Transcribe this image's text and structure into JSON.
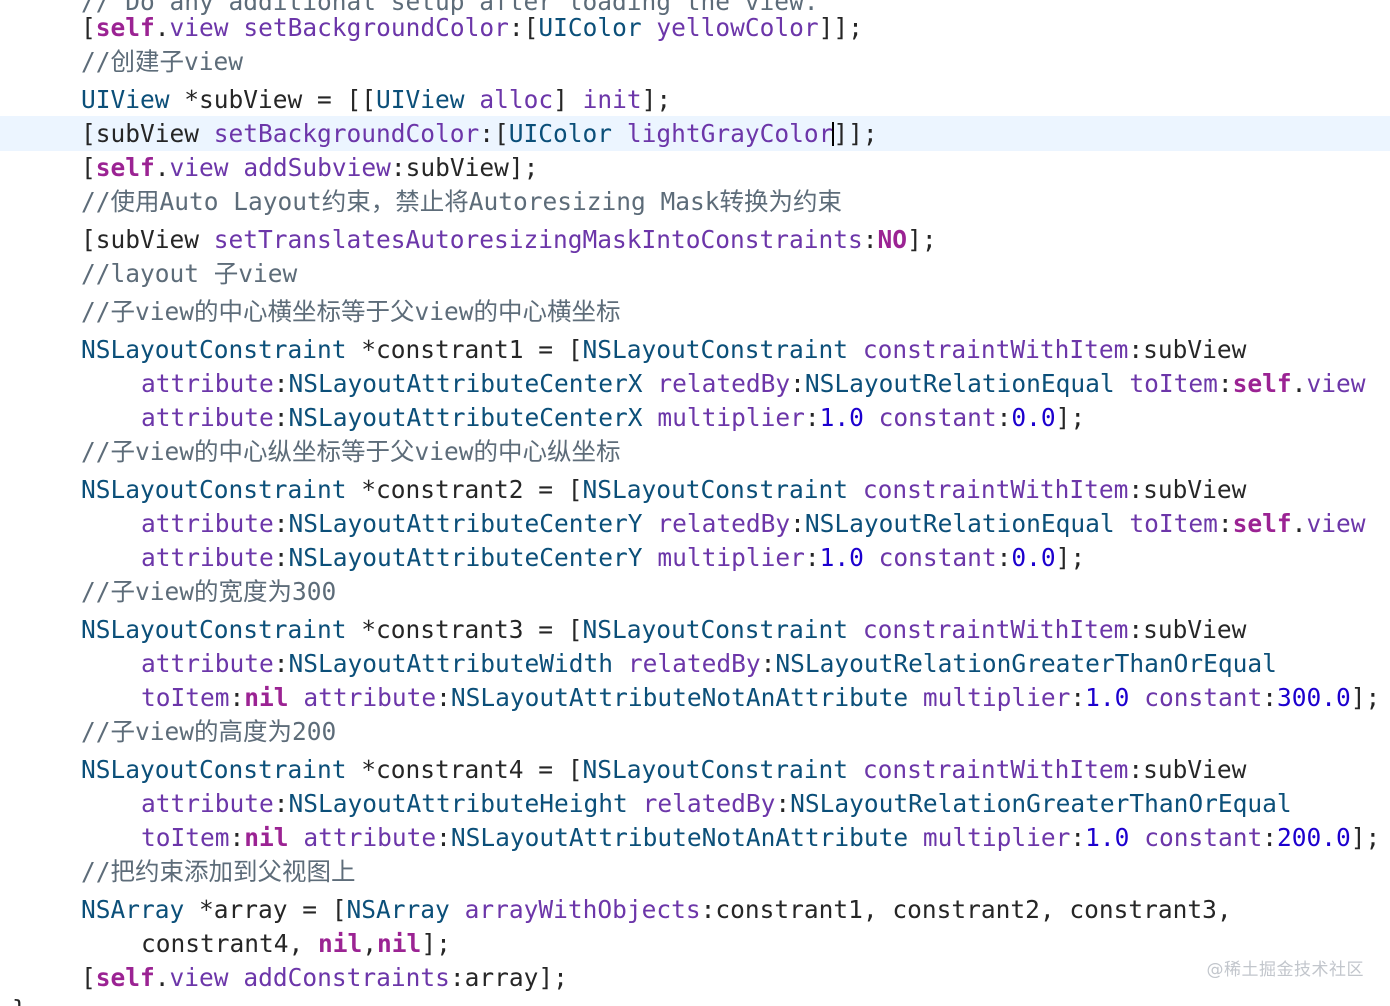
{
  "editor": {
    "lines": [
      {
        "indent": 1,
        "tokens": [
          {
            "c": "c",
            "t": "// Do any additional setup after loading the view."
          }
        ]
      },
      {
        "indent": 1,
        "tokens": [
          {
            "c": "p",
            "t": "["
          },
          {
            "c": "k",
            "t": "self"
          },
          {
            "c": "p",
            "t": "."
          },
          {
            "c": "m",
            "t": "view"
          },
          {
            "c": "p",
            "t": " "
          },
          {
            "c": "m",
            "t": "setBackgroundColor"
          },
          {
            "c": "p",
            "t": ":["
          },
          {
            "c": "t",
            "t": "UIColor"
          },
          {
            "c": "p",
            "t": " "
          },
          {
            "c": "m",
            "t": "yellowColor"
          },
          {
            "c": "p",
            "t": "]];"
          }
        ]
      },
      {
        "indent": 1,
        "tokens": [
          {
            "c": "c",
            "t": "//创建子view"
          }
        ]
      },
      {
        "indent": 1,
        "tokens": [
          {
            "c": "t",
            "t": "UIView"
          },
          {
            "c": "p",
            "t": " *subView = [["
          },
          {
            "c": "t",
            "t": "UIView"
          },
          {
            "c": "p",
            "t": " "
          },
          {
            "c": "m",
            "t": "alloc"
          },
          {
            "c": "p",
            "t": "] "
          },
          {
            "c": "m",
            "t": "init"
          },
          {
            "c": "p",
            "t": "];"
          }
        ]
      },
      {
        "indent": 1,
        "current": true,
        "tokens": [
          {
            "c": "p",
            "t": "[subView "
          },
          {
            "c": "m",
            "t": "setBackgroundColor"
          },
          {
            "c": "p",
            "t": ":["
          },
          {
            "c": "t",
            "t": "UIColor"
          },
          {
            "c": "p",
            "t": " "
          },
          {
            "c": "m",
            "t": "lightGrayColor"
          },
          {
            "c": "cursor",
            "t": ""
          },
          {
            "c": "p",
            "t": "]];"
          }
        ]
      },
      {
        "indent": 1,
        "tokens": [
          {
            "c": "p",
            "t": "["
          },
          {
            "c": "k",
            "t": "self"
          },
          {
            "c": "p",
            "t": "."
          },
          {
            "c": "m",
            "t": "view"
          },
          {
            "c": "p",
            "t": " "
          },
          {
            "c": "m",
            "t": "addSubview"
          },
          {
            "c": "p",
            "t": ":subView];"
          }
        ]
      },
      {
        "indent": 1,
        "tokens": [
          {
            "c": "c",
            "t": "//使用Auto Layout约束，禁止将Autoresizing Mask转换为约束"
          }
        ]
      },
      {
        "indent": 1,
        "tokens": [
          {
            "c": "p",
            "t": "[subView "
          },
          {
            "c": "m",
            "t": "setTranslatesAutoresizingMaskIntoConstraints"
          },
          {
            "c": "p",
            "t": ":"
          },
          {
            "c": "k",
            "t": "NO"
          },
          {
            "c": "p",
            "t": "];"
          }
        ]
      },
      {
        "indent": 1,
        "tokens": [
          {
            "c": "c",
            "t": "//layout 子view"
          }
        ]
      },
      {
        "indent": 1,
        "tokens": [
          {
            "c": "c",
            "t": "//子view的中心横坐标等于父view的中心横坐标"
          }
        ]
      },
      {
        "indent": 1,
        "tokens": [
          {
            "c": "t",
            "t": "NSLayoutConstraint"
          },
          {
            "c": "p",
            "t": " *constrant1 = ["
          },
          {
            "c": "t",
            "t": "NSLayoutConstraint"
          },
          {
            "c": "p",
            "t": " "
          },
          {
            "c": "m",
            "t": "constraintWithItem"
          },
          {
            "c": "p",
            "t": ":subView"
          }
        ]
      },
      {
        "indent": 2,
        "tokens": [
          {
            "c": "m",
            "t": "attribute"
          },
          {
            "c": "p",
            "t": ":"
          },
          {
            "c": "t",
            "t": "NSLayoutAttributeCenterX"
          },
          {
            "c": "p",
            "t": " "
          },
          {
            "c": "m",
            "t": "relatedBy"
          },
          {
            "c": "p",
            "t": ":"
          },
          {
            "c": "t",
            "t": "NSLayoutRelationEqual"
          },
          {
            "c": "p",
            "t": " "
          },
          {
            "c": "m",
            "t": "toItem"
          },
          {
            "c": "p",
            "t": ":"
          },
          {
            "c": "k",
            "t": "self"
          },
          {
            "c": "p",
            "t": "."
          },
          {
            "c": "m",
            "t": "view"
          }
        ]
      },
      {
        "indent": 2,
        "tokens": [
          {
            "c": "m",
            "t": "attribute"
          },
          {
            "c": "p",
            "t": ":"
          },
          {
            "c": "t",
            "t": "NSLayoutAttributeCenterX"
          },
          {
            "c": "p",
            "t": " "
          },
          {
            "c": "m",
            "t": "multiplier"
          },
          {
            "c": "p",
            "t": ":"
          },
          {
            "c": "n",
            "t": "1.0"
          },
          {
            "c": "p",
            "t": " "
          },
          {
            "c": "m",
            "t": "constant"
          },
          {
            "c": "p",
            "t": ":"
          },
          {
            "c": "n",
            "t": "0.0"
          },
          {
            "c": "p",
            "t": "];"
          }
        ]
      },
      {
        "indent": 1,
        "tokens": [
          {
            "c": "c",
            "t": "//子view的中心纵坐标等于父view的中心纵坐标"
          }
        ]
      },
      {
        "indent": 1,
        "tokens": [
          {
            "c": "t",
            "t": "NSLayoutConstraint"
          },
          {
            "c": "p",
            "t": " *constrant2 = ["
          },
          {
            "c": "t",
            "t": "NSLayoutConstraint"
          },
          {
            "c": "p",
            "t": " "
          },
          {
            "c": "m",
            "t": "constraintWithItem"
          },
          {
            "c": "p",
            "t": ":subView"
          }
        ]
      },
      {
        "indent": 2,
        "tokens": [
          {
            "c": "m",
            "t": "attribute"
          },
          {
            "c": "p",
            "t": ":"
          },
          {
            "c": "t",
            "t": "NSLayoutAttributeCenterY"
          },
          {
            "c": "p",
            "t": " "
          },
          {
            "c": "m",
            "t": "relatedBy"
          },
          {
            "c": "p",
            "t": ":"
          },
          {
            "c": "t",
            "t": "NSLayoutRelationEqual"
          },
          {
            "c": "p",
            "t": " "
          },
          {
            "c": "m",
            "t": "toItem"
          },
          {
            "c": "p",
            "t": ":"
          },
          {
            "c": "k",
            "t": "self"
          },
          {
            "c": "p",
            "t": "."
          },
          {
            "c": "m",
            "t": "view"
          }
        ]
      },
      {
        "indent": 2,
        "tokens": [
          {
            "c": "m",
            "t": "attribute"
          },
          {
            "c": "p",
            "t": ":"
          },
          {
            "c": "t",
            "t": "NSLayoutAttributeCenterY"
          },
          {
            "c": "p",
            "t": " "
          },
          {
            "c": "m",
            "t": "multiplier"
          },
          {
            "c": "p",
            "t": ":"
          },
          {
            "c": "n",
            "t": "1.0"
          },
          {
            "c": "p",
            "t": " "
          },
          {
            "c": "m",
            "t": "constant"
          },
          {
            "c": "p",
            "t": ":"
          },
          {
            "c": "n",
            "t": "0.0"
          },
          {
            "c": "p",
            "t": "];"
          }
        ]
      },
      {
        "indent": 1,
        "tokens": [
          {
            "c": "c",
            "t": "//子view的宽度为300"
          }
        ]
      },
      {
        "indent": 1,
        "tokens": [
          {
            "c": "t",
            "t": "NSLayoutConstraint"
          },
          {
            "c": "p",
            "t": " *constrant3 = ["
          },
          {
            "c": "t",
            "t": "NSLayoutConstraint"
          },
          {
            "c": "p",
            "t": " "
          },
          {
            "c": "m",
            "t": "constraintWithItem"
          },
          {
            "c": "p",
            "t": ":subView"
          }
        ]
      },
      {
        "indent": 2,
        "tokens": [
          {
            "c": "m",
            "t": "attribute"
          },
          {
            "c": "p",
            "t": ":"
          },
          {
            "c": "t",
            "t": "NSLayoutAttributeWidth"
          },
          {
            "c": "p",
            "t": " "
          },
          {
            "c": "m",
            "t": "relatedBy"
          },
          {
            "c": "p",
            "t": ":"
          },
          {
            "c": "t",
            "t": "NSLayoutRelationGreaterThanOrEqual"
          }
        ]
      },
      {
        "indent": 2,
        "tokens": [
          {
            "c": "m",
            "t": "toItem"
          },
          {
            "c": "p",
            "t": ":"
          },
          {
            "c": "k",
            "t": "nil"
          },
          {
            "c": "p",
            "t": " "
          },
          {
            "c": "m",
            "t": "attribute"
          },
          {
            "c": "p",
            "t": ":"
          },
          {
            "c": "t",
            "t": "NSLayoutAttributeNotAnAttribute"
          },
          {
            "c": "p",
            "t": " "
          },
          {
            "c": "m",
            "t": "multiplier"
          },
          {
            "c": "p",
            "t": ":"
          },
          {
            "c": "n",
            "t": "1.0"
          },
          {
            "c": "p",
            "t": " "
          },
          {
            "c": "m",
            "t": "constant"
          },
          {
            "c": "p",
            "t": ":"
          },
          {
            "c": "n",
            "t": "300.0"
          },
          {
            "c": "p",
            "t": "];"
          }
        ]
      },
      {
        "indent": 1,
        "tokens": [
          {
            "c": "c",
            "t": "//子view的高度为200"
          }
        ]
      },
      {
        "indent": 1,
        "tokens": [
          {
            "c": "t",
            "t": "NSLayoutConstraint"
          },
          {
            "c": "p",
            "t": " *constrant4 = ["
          },
          {
            "c": "t",
            "t": "NSLayoutConstraint"
          },
          {
            "c": "p",
            "t": " "
          },
          {
            "c": "m",
            "t": "constraintWithItem"
          },
          {
            "c": "p",
            "t": ":subView"
          }
        ]
      },
      {
        "indent": 2,
        "tokens": [
          {
            "c": "m",
            "t": "attribute"
          },
          {
            "c": "p",
            "t": ":"
          },
          {
            "c": "t",
            "t": "NSLayoutAttributeHeight"
          },
          {
            "c": "p",
            "t": " "
          },
          {
            "c": "m",
            "t": "relatedBy"
          },
          {
            "c": "p",
            "t": ":"
          },
          {
            "c": "t",
            "t": "NSLayoutRelationGreaterThanOrEqual"
          }
        ]
      },
      {
        "indent": 2,
        "tokens": [
          {
            "c": "m",
            "t": "toItem"
          },
          {
            "c": "p",
            "t": ":"
          },
          {
            "c": "k",
            "t": "nil"
          },
          {
            "c": "p",
            "t": " "
          },
          {
            "c": "m",
            "t": "attribute"
          },
          {
            "c": "p",
            "t": ":"
          },
          {
            "c": "t",
            "t": "NSLayoutAttributeNotAnAttribute"
          },
          {
            "c": "p",
            "t": " "
          },
          {
            "c": "m",
            "t": "multiplier"
          },
          {
            "c": "p",
            "t": ":"
          },
          {
            "c": "n",
            "t": "1.0"
          },
          {
            "c": "p",
            "t": " "
          },
          {
            "c": "m",
            "t": "constant"
          },
          {
            "c": "p",
            "t": ":"
          },
          {
            "c": "n",
            "t": "200.0"
          },
          {
            "c": "p",
            "t": "];"
          }
        ]
      },
      {
        "indent": 1,
        "tokens": [
          {
            "c": "c",
            "t": "//把约束添加到父视图上"
          }
        ]
      },
      {
        "indent": 1,
        "tokens": [
          {
            "c": "t",
            "t": "NSArray"
          },
          {
            "c": "p",
            "t": " *array = ["
          },
          {
            "c": "t",
            "t": "NSArray"
          },
          {
            "c": "p",
            "t": " "
          },
          {
            "c": "m",
            "t": "arrayWithObjects"
          },
          {
            "c": "p",
            "t": ":constrant1, constrant2, constrant3,"
          }
        ]
      },
      {
        "indent": 2,
        "tokens": [
          {
            "c": "p",
            "t": "constrant4, "
          },
          {
            "c": "k",
            "t": "nil"
          },
          {
            "c": "p",
            "t": ","
          },
          {
            "c": "k",
            "t": "nil"
          },
          {
            "c": "p",
            "t": "];"
          }
        ]
      },
      {
        "indent": 1,
        "tokens": [
          {
            "c": "p",
            "t": "["
          },
          {
            "c": "k",
            "t": "self"
          },
          {
            "c": "p",
            "t": "."
          },
          {
            "c": "m",
            "t": "view"
          },
          {
            "c": "p",
            "t": " "
          },
          {
            "c": "m",
            "t": "addConstraints"
          },
          {
            "c": "p",
            "t": ":array];"
          }
        ]
      },
      {
        "indent": 0,
        "tokens": [
          {
            "c": "p",
            "t": "}"
          }
        ]
      }
    ]
  },
  "watermark": {
    "text": "@稀土掘金技术社区"
  }
}
